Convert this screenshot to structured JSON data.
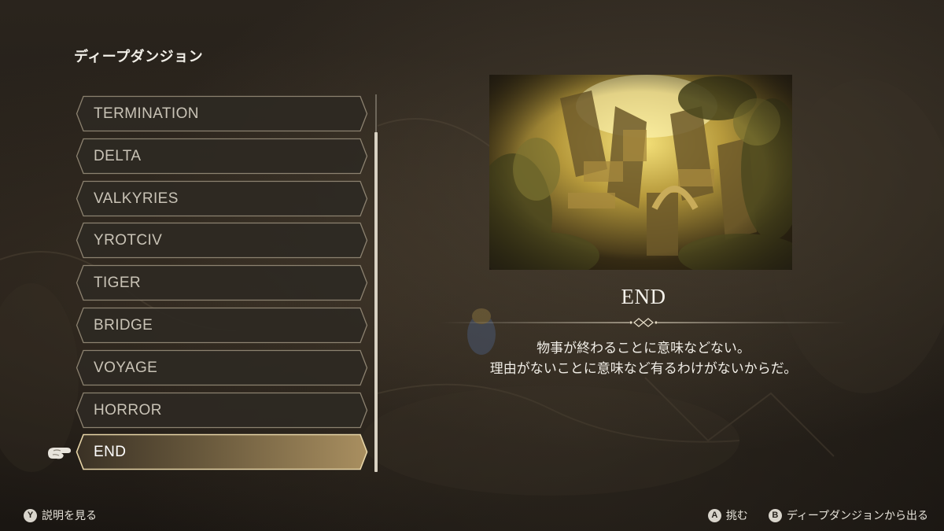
{
  "page": {
    "title": "ディープダンジョン"
  },
  "dungeon_list": {
    "items": [
      {
        "label": "TERMINATION",
        "selected": false
      },
      {
        "label": "DELTA",
        "selected": false
      },
      {
        "label": "VALKYRIES",
        "selected": false
      },
      {
        "label": "YROTCIV",
        "selected": false
      },
      {
        "label": "TIGER",
        "selected": false
      },
      {
        "label": "BRIDGE",
        "selected": false
      },
      {
        "label": "VOYAGE",
        "selected": false
      },
      {
        "label": "HORROR",
        "selected": false
      },
      {
        "label": "END",
        "selected": true
      }
    ],
    "selected_index": 8,
    "cursor_icon": "pointing-hand-icon"
  },
  "detail": {
    "title": "END",
    "description_line1": "物事が終わることに意味などない。",
    "description_line2": "理由がないことに意味など有るわけがないからだ。",
    "preview_image": "golden-ruins-forest-artwork"
  },
  "footer": {
    "left": {
      "button": "Y",
      "label": "説明を見る"
    },
    "right": [
      {
        "button": "A",
        "label": "挑む"
      },
      {
        "button": "B",
        "label": "ディープダンジョンから出る"
      }
    ]
  },
  "colors": {
    "background": "#221d17",
    "item_fill": "#2e2923",
    "item_border": "#8c8270",
    "selected_fill_left": "#5f5138",
    "selected_fill_right": "#a98f60",
    "selected_border": "#e8d6a8",
    "text_primary": "#f2efe8",
    "text_item": "#c9c3b6",
    "accent_gold": "#c9a763"
  }
}
